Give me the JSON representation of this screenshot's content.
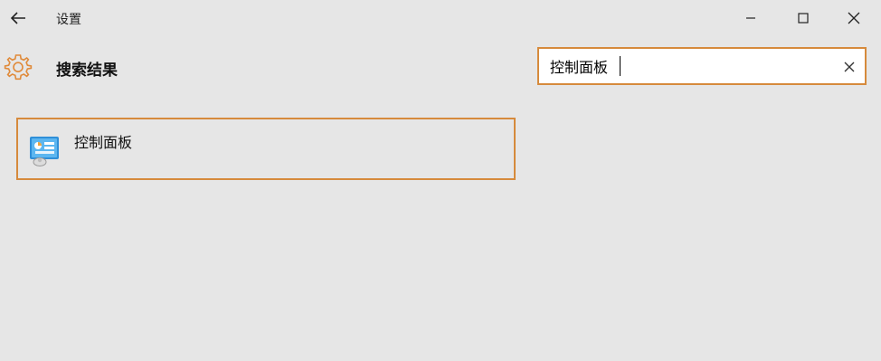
{
  "titlebar": {
    "title": "设置",
    "back_icon": "arrow-left-icon",
    "minimize_icon": "minimize-icon",
    "maximize_icon": "maximize-icon",
    "close_icon": "close-icon"
  },
  "header": {
    "icon": "gear-icon",
    "title": "搜索结果"
  },
  "search": {
    "value": "控制面板",
    "clear_icon": "clear-icon"
  },
  "results": [
    {
      "label": "控制面板",
      "icon": "control-panel-icon"
    }
  ],
  "colors": {
    "background": "#e6e6e6",
    "accent_border": "#d68a3c",
    "gear_color": "#e08a3a"
  }
}
